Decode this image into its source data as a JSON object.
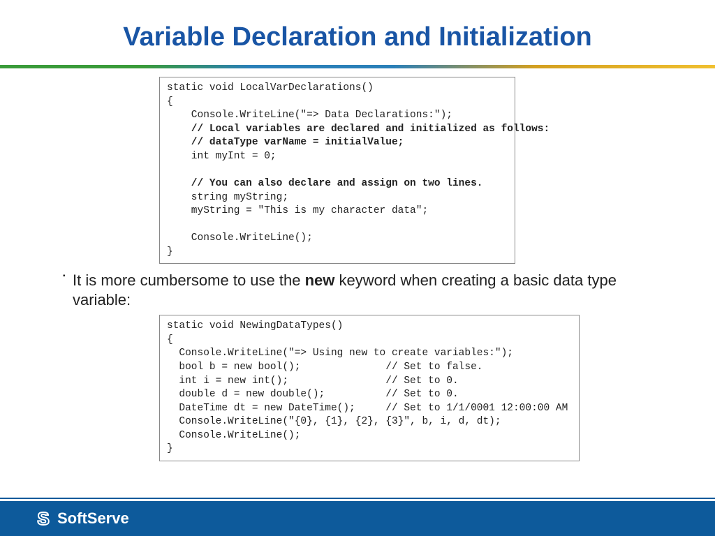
{
  "title": "Variable Declaration and Initialization",
  "code1": {
    "l1": "static void LocalVarDeclarations()",
    "l2": "{",
    "l3": "    Console.WriteLine(\"=> Data Declarations:\");",
    "l4": "    // Local variables are declared and initialized as follows:",
    "l5": "    // dataType varName = initialValue;",
    "l6": "    int myInt = 0;",
    "l7": "",
    "l8": "    // You can also declare and assign on two lines.",
    "l9": "    string myString;",
    "l10": "    myString = \"This is my character data\";",
    "l11": "",
    "l12": "    Console.WriteLine();",
    "l13": "}"
  },
  "bullet": {
    "part1": "It is more cumbersome to use the ",
    "bold": "new",
    "part2": " keyword when creating a basic data type variable:"
  },
  "code2": {
    "l1": "static void NewingDataTypes()",
    "l2": "{",
    "l3": "  Console.WriteLine(\"=> Using new to create variables:\");",
    "l4": "  bool b = new bool();              // Set to false.",
    "l5": "  int i = new int();                // Set to 0.",
    "l6": "  double d = new double();          // Set to 0.",
    "l7": "  DateTime dt = new DateTime();     // Set to 1/1/0001 12:00:00 AM",
    "l8": "  Console.WriteLine(\"{0}, {1}, {2}, {3}\", b, i, d, dt);",
    "l9": "  Console.WriteLine();",
    "l10": "}"
  },
  "footer": {
    "brand": "SoftServe"
  }
}
